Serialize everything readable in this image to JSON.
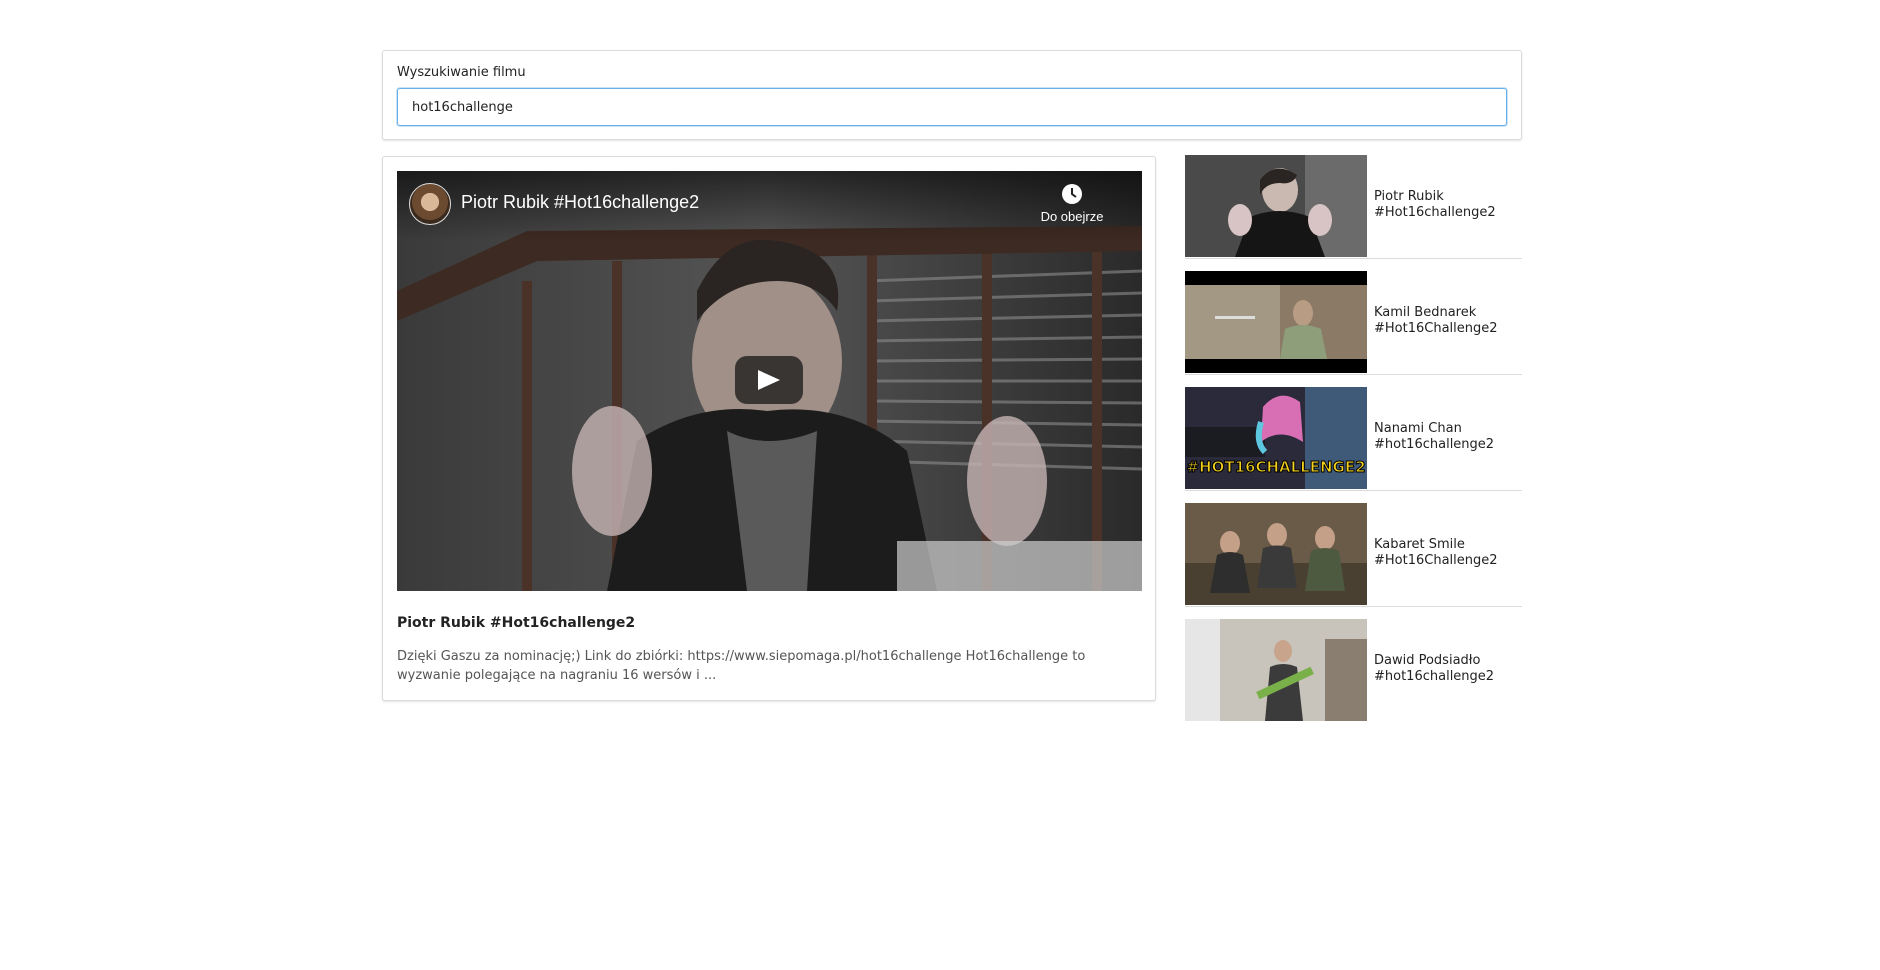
{
  "search": {
    "label": "Wyszukiwanie filmu",
    "value": "hot16challenge",
    "placeholder": ""
  },
  "player": {
    "title": "Piotr Rubik #Hot16challenge2",
    "watch_later": "Do obejrze",
    "icons": [
      "channel-avatar",
      "clock-icon",
      "play-icon"
    ]
  },
  "video": {
    "title": "Piotr Rubik #Hot16challenge2",
    "description": "Dzięki Gaszu za nominację;) Link do zbiórki: https://www.siepomaga.pl/hot16challenge Hot16challenge to wyzwanie polegające na nagraniu 16 wersów i ..."
  },
  "related": [
    {
      "title": "Piotr Rubik #Hot16challenge2"
    },
    {
      "title": "Kamil Bednarek #Hot16Challenge2"
    },
    {
      "title": "Nanami Chan #hot16challenge2",
      "thumb_overlay": "#HOT16CHALLENGE2"
    },
    {
      "title": "Kabaret Smile #Hot16Challenge2"
    },
    {
      "title": "Dawid Podsiadło #hot16challenge2"
    }
  ],
  "colors": {
    "focus_border": "#66afe9",
    "card_border": "#dcdcdc",
    "nanami_overlay_text": "#f5d21b"
  }
}
